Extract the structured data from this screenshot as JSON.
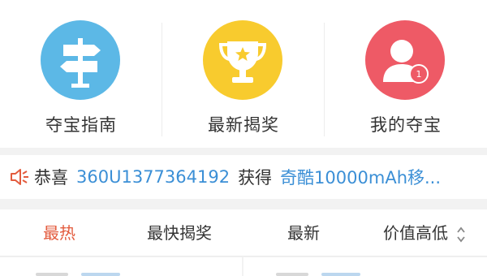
{
  "shortcuts": [
    {
      "label": "夺宝指南",
      "icon": "signpost-icon",
      "color": "#5cb8e6"
    },
    {
      "label": "最新揭奖",
      "icon": "trophy-icon",
      "color": "#f8cb2e"
    },
    {
      "label": "我的夺宝",
      "icon": "user-coin-icon",
      "color": "#ee5a66"
    }
  ],
  "notice": {
    "icon": "speaker-icon",
    "prefix": "恭喜",
    "user": "360U1377364192",
    "verb": "获得",
    "prize": "奇酷10000mAh移...",
    "colors": {
      "accent": "#3b8fd6",
      "icon": "#e35b3d"
    }
  },
  "tabs": [
    {
      "label": "最热",
      "active": true
    },
    {
      "label": "最快揭奖",
      "active": false
    },
    {
      "label": "最新",
      "active": false
    },
    {
      "label": "价值高低",
      "active": false,
      "icon": "sort-arrows-icon"
    }
  ],
  "accent_color": "#e35b3d"
}
